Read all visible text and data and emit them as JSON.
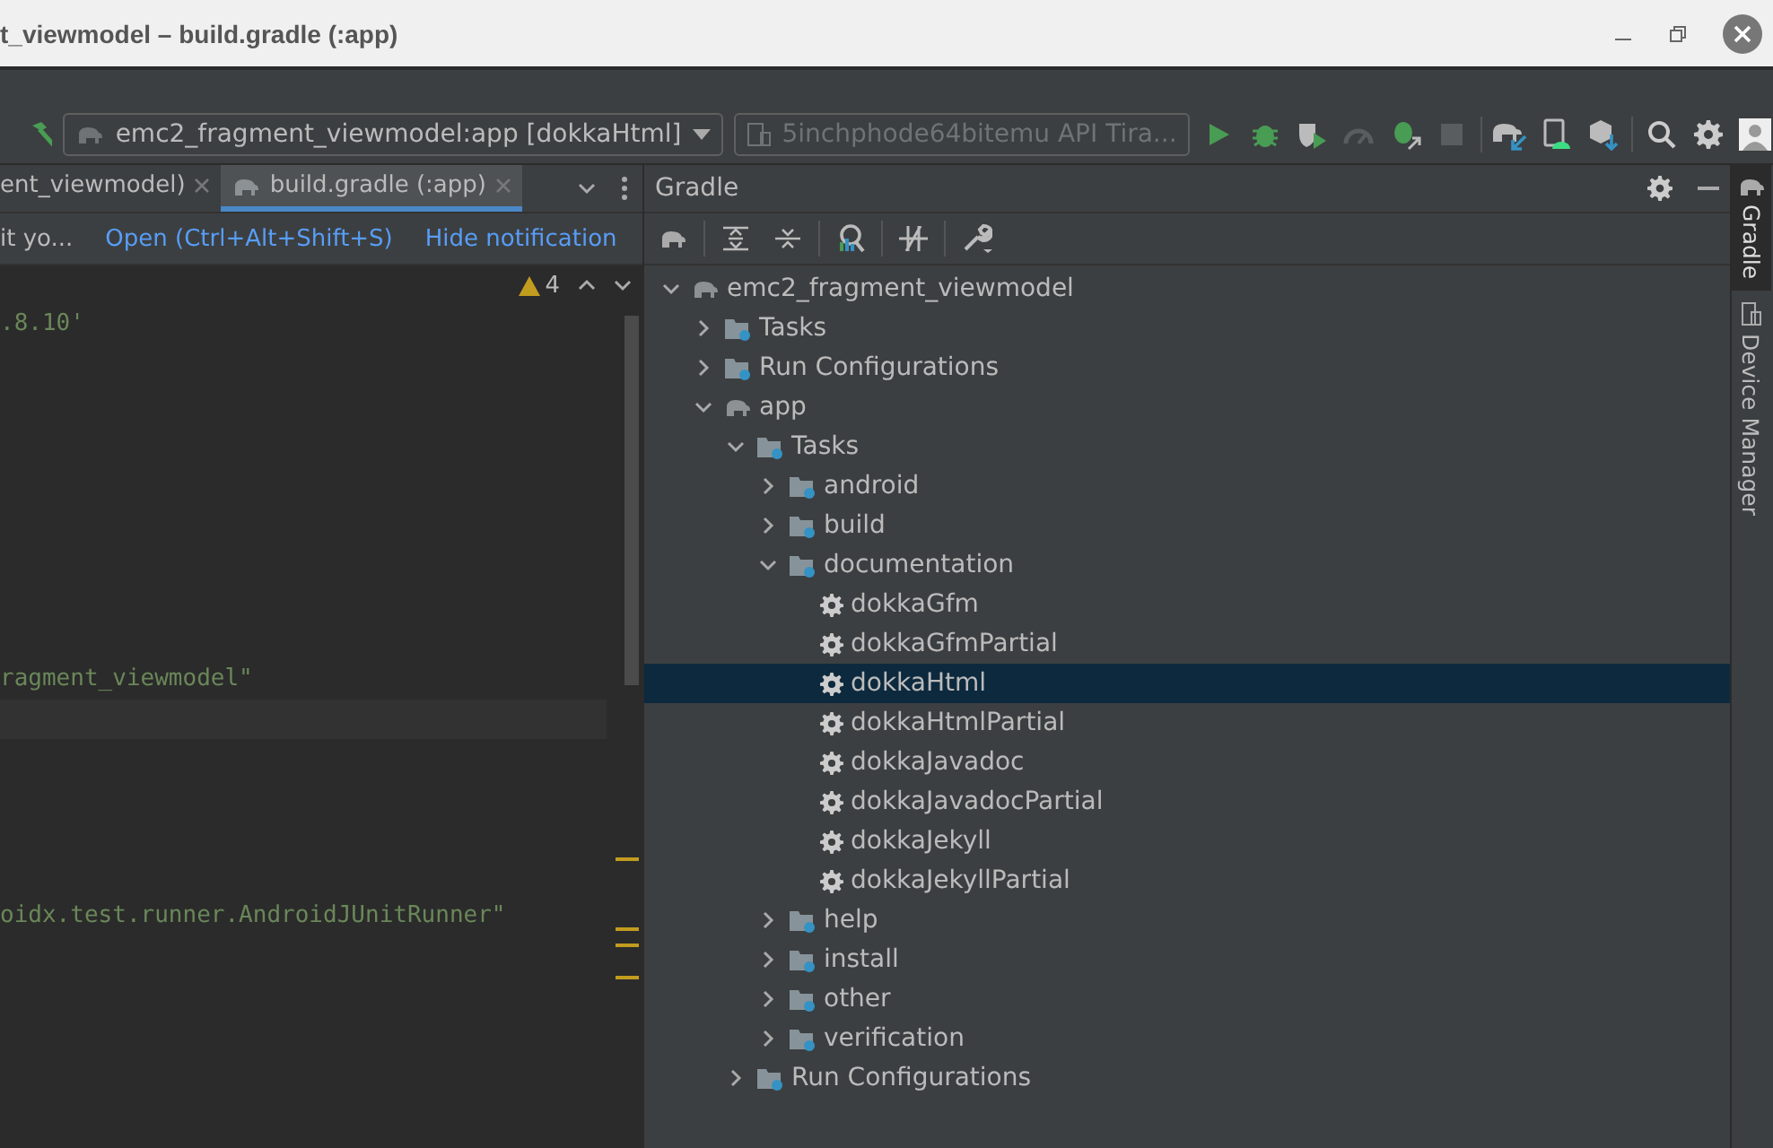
{
  "window": {
    "title": "t_viewmodel – build.gradle (:app)"
  },
  "toolbar": {
    "run_config": "emc2_fragment_viewmodel:app [dokkaHtml]",
    "device": {
      "label": "5inchphode64bitemu API Tira...",
      "disabled": true
    },
    "actions": [
      {
        "kind": "run",
        "disabled": false
      },
      {
        "kind": "debug",
        "disabled": false
      },
      {
        "kind": "coverage",
        "disabled": false
      },
      {
        "kind": "profile",
        "disabled": true
      },
      {
        "kind": "attach",
        "disabled": false
      },
      {
        "kind": "stop",
        "disabled": true
      },
      {
        "kind": "sync",
        "disabled": false
      },
      {
        "kind": "device",
        "disabled": false
      },
      {
        "kind": "sdk",
        "disabled": false
      },
      {
        "kind": "search",
        "disabled": false
      },
      {
        "kind": "settings",
        "disabled": false
      },
      {
        "kind": "avatar",
        "disabled": false
      }
    ]
  },
  "editor_tabs": [
    {
      "label": "ent_viewmodel)",
      "selected": false,
      "kind": "plain"
    },
    {
      "label": "build.gradle (:app)",
      "selected": true,
      "kind": "gradle"
    }
  ],
  "notification": {
    "text": "it yo...",
    "links": [
      "Open (Ctrl+Alt+Shift+S)",
      "Hide notification"
    ]
  },
  "editor": {
    "warnings": "4",
    "lines": [
      ".8.10'",
      "ragment_viewmodel\"",
      "oidx.test.runner.AndroidJUnitRunner\""
    ]
  },
  "gradle": {
    "title": "Gradle",
    "tree": [
      {
        "label": "emc2_fragment_viewmodel",
        "kind": "project",
        "expanded": true,
        "selected": false,
        "children": [
          {
            "label": "Tasks",
            "kind": "folder",
            "expanded": false,
            "selected": false
          },
          {
            "label": "Run Configurations",
            "kind": "folder",
            "expanded": false,
            "selected": false
          },
          {
            "label": "app",
            "kind": "project",
            "expanded": true,
            "selected": false,
            "children": [
              {
                "label": "Tasks",
                "kind": "folder",
                "expanded": true,
                "selected": false,
                "children": [
                  {
                    "label": "android",
                    "kind": "folder",
                    "expanded": false,
                    "selected": false
                  },
                  {
                    "label": "build",
                    "kind": "folder",
                    "expanded": false,
                    "selected": false
                  },
                  {
                    "label": "documentation",
                    "kind": "folder",
                    "expanded": true,
                    "selected": false,
                    "children": [
                      {
                        "label": "dokkaGfm",
                        "kind": "task",
                        "selected": false
                      },
                      {
                        "label": "dokkaGfmPartial",
                        "kind": "task",
                        "selected": false
                      },
                      {
                        "label": "dokkaHtml",
                        "kind": "task",
                        "selected": true
                      },
                      {
                        "label": "dokkaHtmlPartial",
                        "kind": "task",
                        "selected": false
                      },
                      {
                        "label": "dokkaJavadoc",
                        "kind": "task",
                        "selected": false
                      },
                      {
                        "label": "dokkaJavadocPartial",
                        "kind": "task",
                        "selected": false
                      },
                      {
                        "label": "dokkaJekyll",
                        "kind": "task",
                        "selected": false
                      },
                      {
                        "label": "dokkaJekyllPartial",
                        "kind": "task",
                        "selected": false
                      }
                    ]
                  },
                  {
                    "label": "help",
                    "kind": "folder",
                    "expanded": false,
                    "selected": false
                  },
                  {
                    "label": "install",
                    "kind": "folder",
                    "expanded": false,
                    "selected": false
                  },
                  {
                    "label": "other",
                    "kind": "folder",
                    "expanded": false,
                    "selected": false
                  },
                  {
                    "label": "verification",
                    "kind": "folder",
                    "expanded": false,
                    "selected": false
                  }
                ]
              },
              {
                "label": "Run Configurations",
                "kind": "folder",
                "expanded": false,
                "selected": false
              }
            ]
          }
        ]
      }
    ]
  },
  "side_tabs": [
    {
      "label": "Gradle",
      "selected": true,
      "kind": "gradle"
    },
    {
      "label": "Device Manager",
      "selected": false,
      "kind": "device"
    }
  ]
}
